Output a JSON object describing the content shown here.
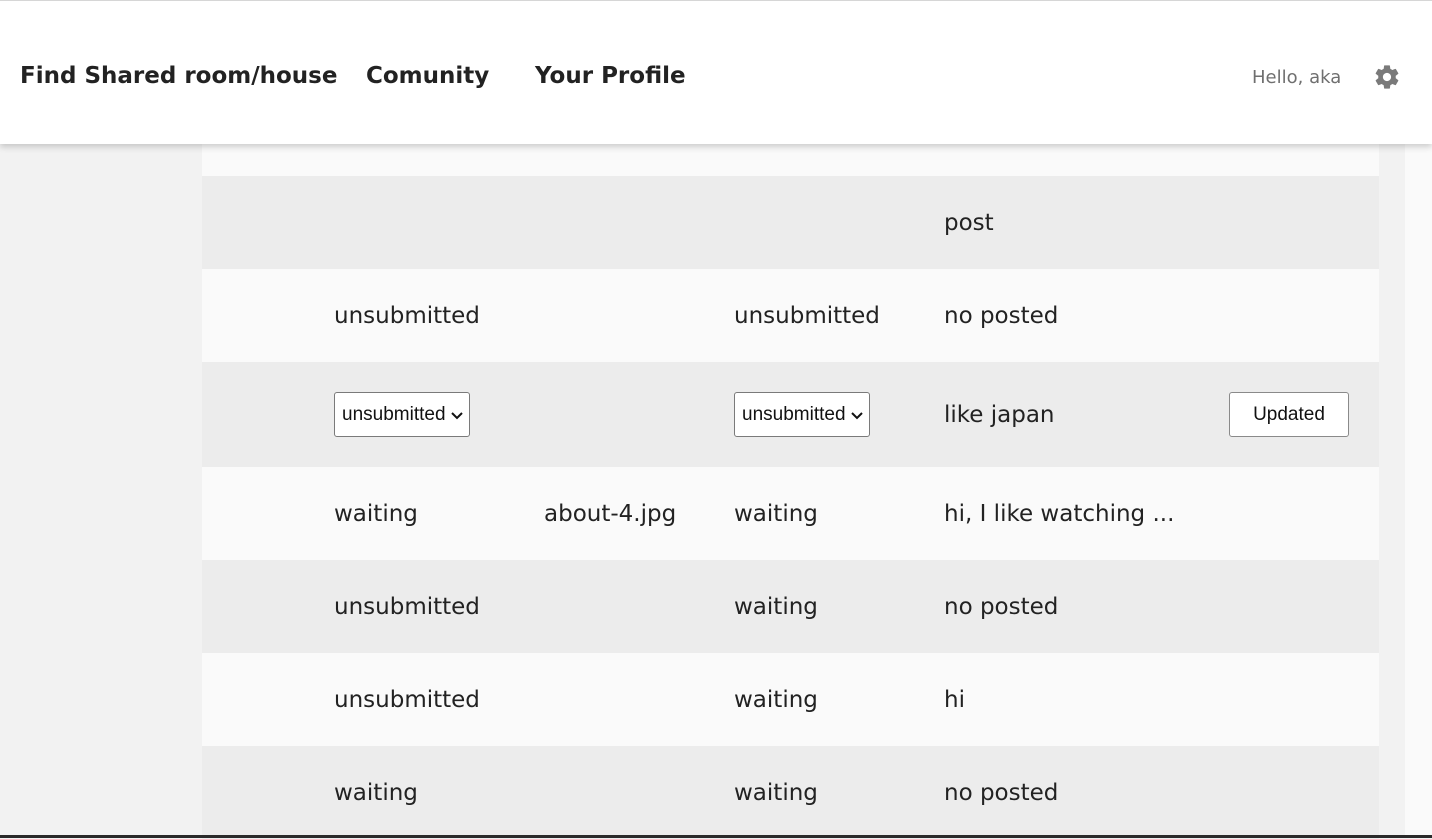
{
  "header": {
    "nav": [
      "Find Shared room/house",
      "Comunity",
      "Your Profile"
    ],
    "greeting": "Hello, aka",
    "settings_icon": "gear-icon"
  },
  "table": {
    "rows": [
      {
        "col1": "",
        "col2": "",
        "col3": "",
        "message": "post"
      },
      {
        "col1": "unsubmitted",
        "col2": "",
        "col3": "unsubmitted",
        "message": "no posted"
      },
      {
        "col1_select": "unsubmitted",
        "col3_select": "unsubmitted",
        "message": "like japan",
        "action": "Updated"
      },
      {
        "col1": "waiting",
        "col2": "about-4.jpg",
        "col3": "waiting",
        "message": "hi, I like watching ..."
      },
      {
        "col1": "unsubmitted",
        "col2": "",
        "col3": "waiting",
        "message": "no posted"
      },
      {
        "col1": "unsubmitted",
        "col2": "",
        "col3": "waiting",
        "message": "hi"
      },
      {
        "col1": "waiting",
        "col2": "",
        "col3": "waiting",
        "message": "no posted"
      }
    ]
  },
  "colors": {
    "header_bg": "#ffffff",
    "row_light": "#fafafa",
    "row_shaded": "#ececec",
    "page_bg": "#f2f2f2",
    "icon_gray": "#7a7a7a"
  }
}
